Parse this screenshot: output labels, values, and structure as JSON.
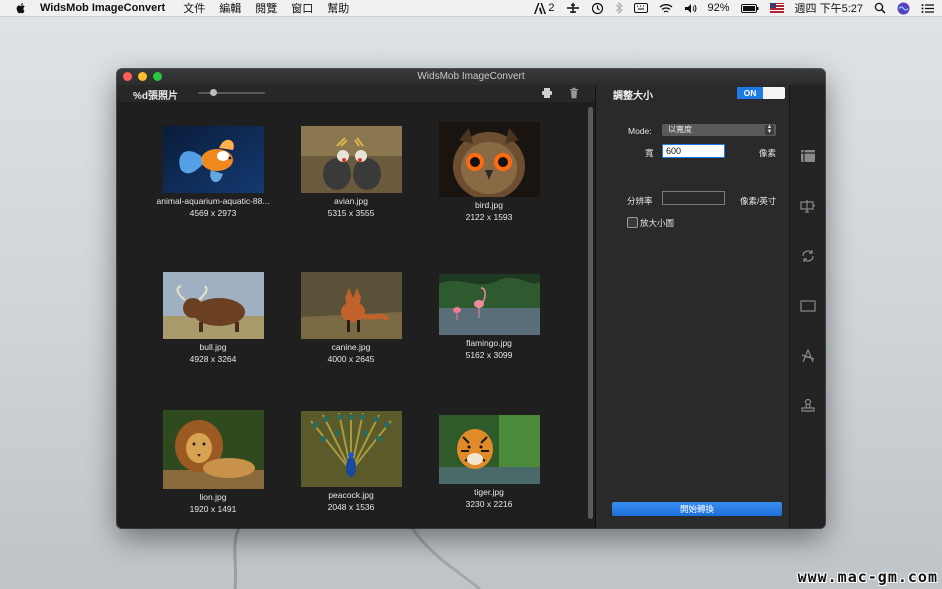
{
  "menubar": {
    "app_name": "WidsMob ImageConvert",
    "menus": [
      "文件",
      "編輯",
      "閱覽",
      "窗口",
      "幫助"
    ],
    "input_indicator": "2",
    "battery_percent": "92%",
    "datetime": "週四 下午5:27"
  },
  "window": {
    "title": "WidsMob ImageConvert"
  },
  "toolbar": {
    "photo_count_label": "%d張照片",
    "zoom_fraction": 0.2
  },
  "gallery": {
    "items": [
      {
        "name": "animal-aquarium-aquatic-88...",
        "dims": "4569 x 2973"
      },
      {
        "name": "avian.jpg",
        "dims": "5315 x 3555"
      },
      {
        "name": "bird.jpg",
        "dims": "2122 x 1593"
      },
      {
        "name": "bull.jpg",
        "dims": "4928 x 3264"
      },
      {
        "name": "canine.jpg",
        "dims": "4000 x 2645"
      },
      {
        "name": "flamingo.jpg",
        "dims": "5162 x 3099"
      },
      {
        "name": "lion.jpg",
        "dims": "1920 x 1491"
      },
      {
        "name": "peacock.jpg",
        "dims": "2048 x 1536"
      },
      {
        "name": "tiger.jpg",
        "dims": "3230 x 2216"
      }
    ]
  },
  "panel": {
    "title": "調整大小",
    "toggle_label": "ON",
    "mode_label": "Mode:",
    "mode_value": "以寬度",
    "width_label": "寬",
    "width_value": "600",
    "width_unit": "像素",
    "resolution_label": "分辨率",
    "resolution_value": "",
    "resolution_unit": "像素/英寸",
    "enlarge_label": "放大小圖",
    "convert_button": "開始轉換"
  },
  "watermark": "www.mac-gm.com",
  "colors": {
    "accent": "#1e7ae6",
    "window_bg": "#1f1f1f",
    "panel_bg": "#2a2a2a"
  }
}
